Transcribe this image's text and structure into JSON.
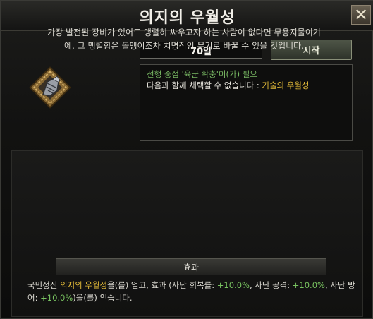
{
  "window": {
    "title": "의지의 우월성"
  },
  "controls": {
    "days": "70일",
    "start_label": "시작"
  },
  "requirement": {
    "line1_prefix": "선행 중점 '육군 확충'이(가) 필요",
    "excl_text": "다음과 함께 채택할 수 없습니다 : ",
    "excl_focus": "기술의 우월성"
  },
  "description": "가장 발전된 장비가 있어도 맹렬히 싸우고자 하는 사람이 없다면 무용지물이기에, 그 맹렬함은 돌멩이조차 치명적인 무기로 바꿀 수 있을 것입니다.",
  "effect": {
    "header": "효과",
    "p1": "국민정신 ",
    "spirit": "의지의 우월성",
    "p2": "을(를) 얻고, 효과 (사단 회복률: ",
    "v1": "+10.0%",
    "p3": ", 사단 공격: ",
    "v2": "+10.0%",
    "p4": ", 사단 방어: ",
    "v3": "+10.0%",
    "p5": ")을(를) 얻습니다."
  },
  "colors": {
    "requirement": "#78b863",
    "highlight": "#e0b838",
    "bonus": "#78c260"
  },
  "icons": {
    "close": "close-icon",
    "focus": "armored-fist-icon"
  }
}
